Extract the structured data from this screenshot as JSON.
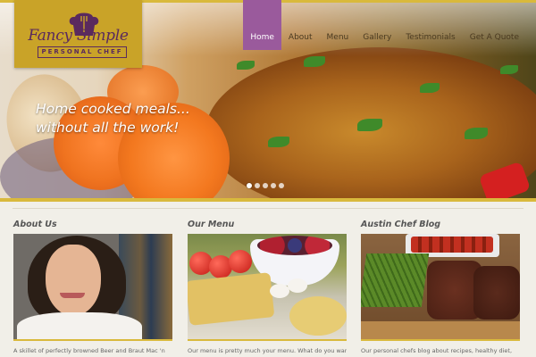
{
  "logo": {
    "brand": "Fancy Simple",
    "sub": "PERSONAL CHEF"
  },
  "nav": {
    "items": [
      {
        "label": "Home",
        "active": true
      },
      {
        "label": "About",
        "active": false
      },
      {
        "label": "Menu",
        "active": false
      },
      {
        "label": "Gallery",
        "active": false
      },
      {
        "label": "Testimonials",
        "active": false
      },
      {
        "label": "Get A Quote",
        "active": false
      }
    ]
  },
  "hero": {
    "line1": "Home cooked meals...",
    "line2": "without all the work!",
    "slides": 5,
    "current_slide": 1
  },
  "sections": {
    "about": {
      "title": "About Us",
      "text": "A skillet of perfectly browned Beer and Braut Mac 'n"
    },
    "menu": {
      "title": "Our Menu",
      "text": "Our menu is pretty much your menu. What do you want"
    },
    "blog": {
      "title": "Austin Chef Blog",
      "text": "Our personal chefs blog about recipes, healthy diet,"
    }
  },
  "colors": {
    "accent": "#d9b93c",
    "logo_bg": "#c9a328",
    "brand_purple": "#5a2a5e",
    "nav_active": "#9a5a9c"
  }
}
